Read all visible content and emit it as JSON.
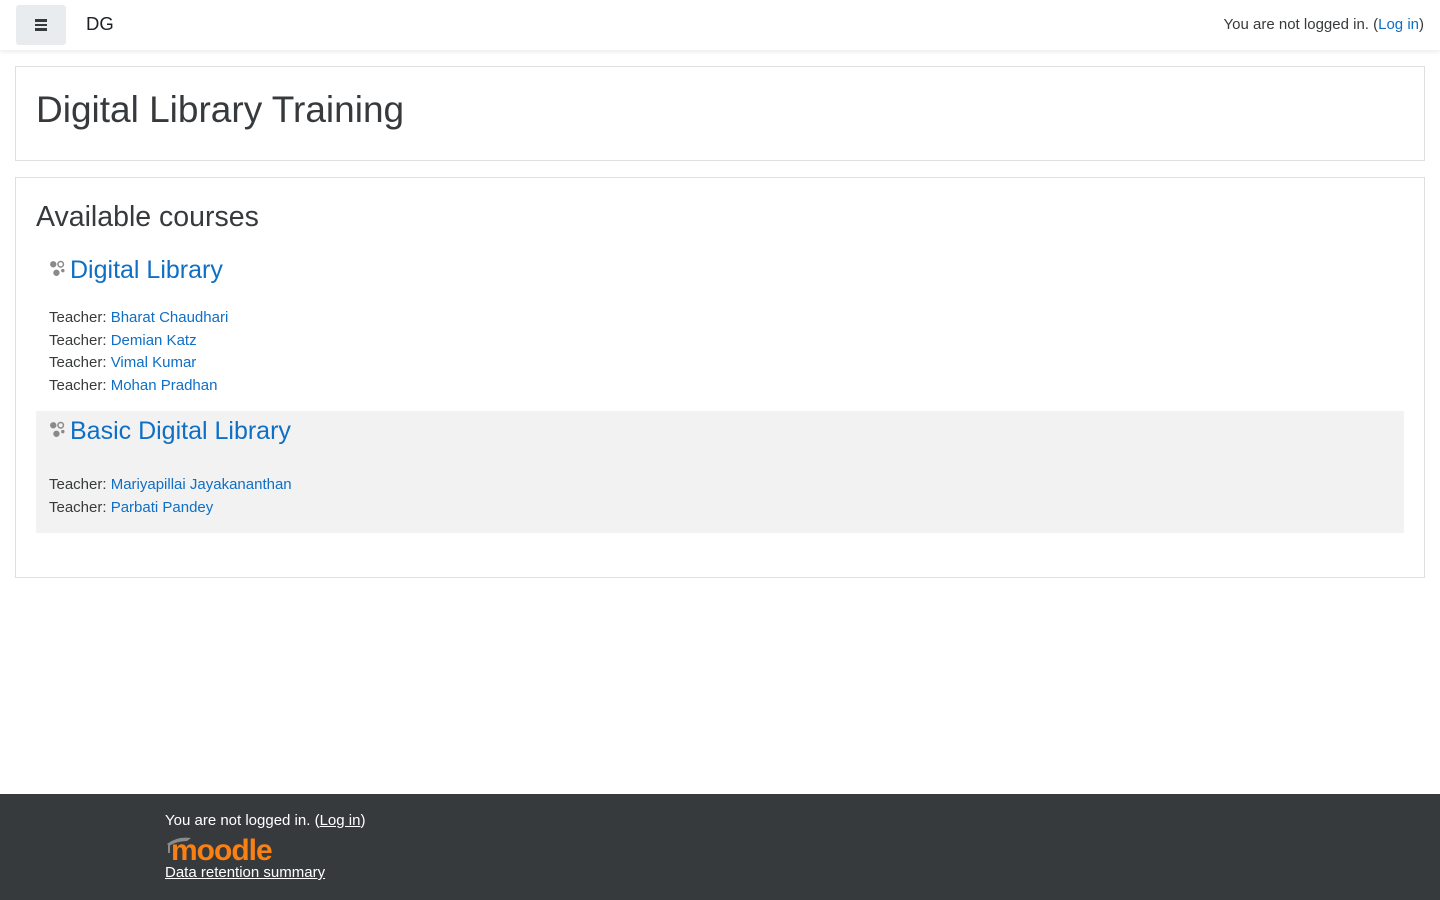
{
  "navbar": {
    "site_name": "DG",
    "login_prefix": "You are not logged in. (",
    "login_link": "Log in",
    "login_suffix": ")"
  },
  "page": {
    "title": "Digital Library Training"
  },
  "courses": {
    "heading": "Available courses",
    "items": [
      {
        "name": "Digital Library",
        "teachers": [
          {
            "role": "Teacher: ",
            "name": "Bharat Chaudhari"
          },
          {
            "role": "Teacher: ",
            "name": "Demian Katz"
          },
          {
            "role": "Teacher: ",
            "name": "Vimal Kumar"
          },
          {
            "role": "Teacher: ",
            "name": "Mohan Pradhan"
          }
        ]
      },
      {
        "name": "Basic Digital Library",
        "teachers": [
          {
            "role": "Teacher: ",
            "name": "Mariyapillai Jayakananthan"
          },
          {
            "role": "Teacher: ",
            "name": "Parbati Pandey"
          }
        ]
      }
    ]
  },
  "footer": {
    "login_prefix": "You are not logged in. (",
    "login_link": "Log in",
    "login_suffix": ")",
    "logo_text": "moodle",
    "retention_link": "Data retention summary"
  },
  "colors": {
    "link": "#0f6fc5",
    "footer_bg": "#373a3c",
    "moodle_orange": "#f98012",
    "stripe_bg": "#f2f2f2"
  }
}
